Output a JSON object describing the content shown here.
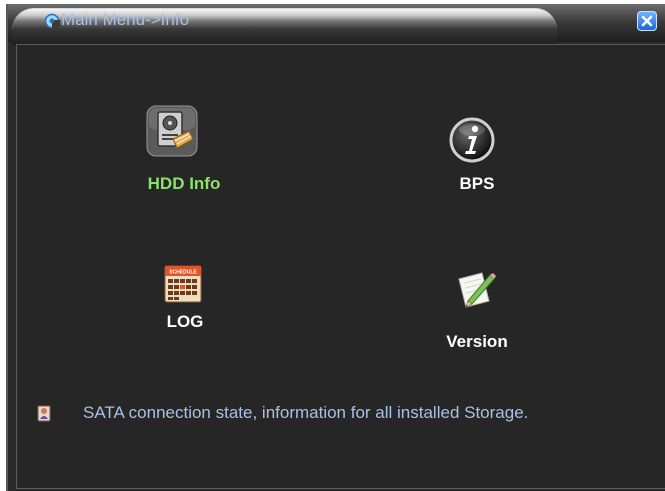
{
  "window": {
    "title": "Main Menu->Info"
  },
  "menu": {
    "items": [
      {
        "label": "HDD Info",
        "icon": "hdd-info-icon",
        "selected": true
      },
      {
        "label": "BPS",
        "icon": "info-i-icon",
        "selected": false
      },
      {
        "label": "LOG",
        "icon": "calendar-schedule-icon",
        "selected": false
      },
      {
        "label": "Version",
        "icon": "pencil-notepad-icon",
        "selected": false
      }
    ],
    "log_icon_caption": "SCHEDULE"
  },
  "hint": {
    "text": "SATA connection state, information for all installed Storage.",
    "icon": "hint-person-icon"
  },
  "colors": {
    "selected_label": "#8ee06a",
    "label": "#ffffff",
    "title_text": "#a9c1e6",
    "hint_text": "#a9c1e6"
  }
}
